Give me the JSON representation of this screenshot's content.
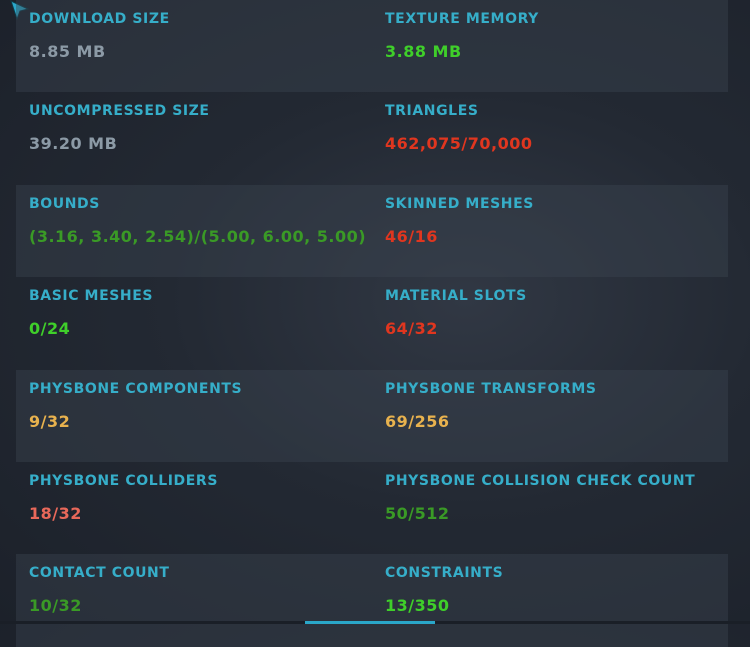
{
  "colors": {
    "label": "#36aec9",
    "neutral": "#8c9aa6",
    "good": "#3fcf2a",
    "okay": "#3a9a26",
    "medium": "#e8b24e",
    "poor": "#e8685a",
    "very_poor": "#e0361f"
  },
  "stats": [
    {
      "left": {
        "label": "DOWNLOAD SIZE",
        "value": "8.85 MB",
        "color": "#8c9aa6"
      },
      "right": {
        "label": "TEXTURE MEMORY",
        "value": "3.88 MB",
        "color": "#3fcf2a"
      }
    },
    {
      "left": {
        "label": "UNCOMPRESSED SIZE",
        "value": "39.20 MB",
        "color": "#8c9aa6"
      },
      "right": {
        "label": "TRIANGLES",
        "value": "462,075/70,000",
        "color": "#e0361f"
      }
    },
    {
      "left": {
        "label": "BOUNDS",
        "value": "(3.16, 3.40, 2.54)/(5.00, 6.00, 5.00)",
        "color": "#3a9a26"
      },
      "right": {
        "label": "SKINNED MESHES",
        "value": "46/16",
        "color": "#e0361f"
      }
    },
    {
      "left": {
        "label": "BASIC MESHES",
        "value": "0/24",
        "color": "#3fcf2a"
      },
      "right": {
        "label": "MATERIAL SLOTS",
        "value": "64/32",
        "color": "#e0361f"
      }
    },
    {
      "left": {
        "label": "PHYSBONE COMPONENTS",
        "value": "9/32",
        "color": "#e8b24e"
      },
      "right": {
        "label": "PHYSBONE TRANSFORMS",
        "value": "69/256",
        "color": "#e8b24e"
      }
    },
    {
      "left": {
        "label": "PHYSBONE COLLIDERS",
        "value": "18/32",
        "color": "#e8685a"
      },
      "right": {
        "label": "PHYSBONE COLLISION CHECK COUNT",
        "value": "50/512",
        "color": "#3a9a26"
      }
    },
    {
      "left": {
        "label": "CONTACT COUNT",
        "value": "10/32",
        "color": "#3a9a26"
      },
      "right": {
        "label": "CONSTRAINTS",
        "value": "13/350",
        "color": "#3fcf2a"
      }
    }
  ]
}
